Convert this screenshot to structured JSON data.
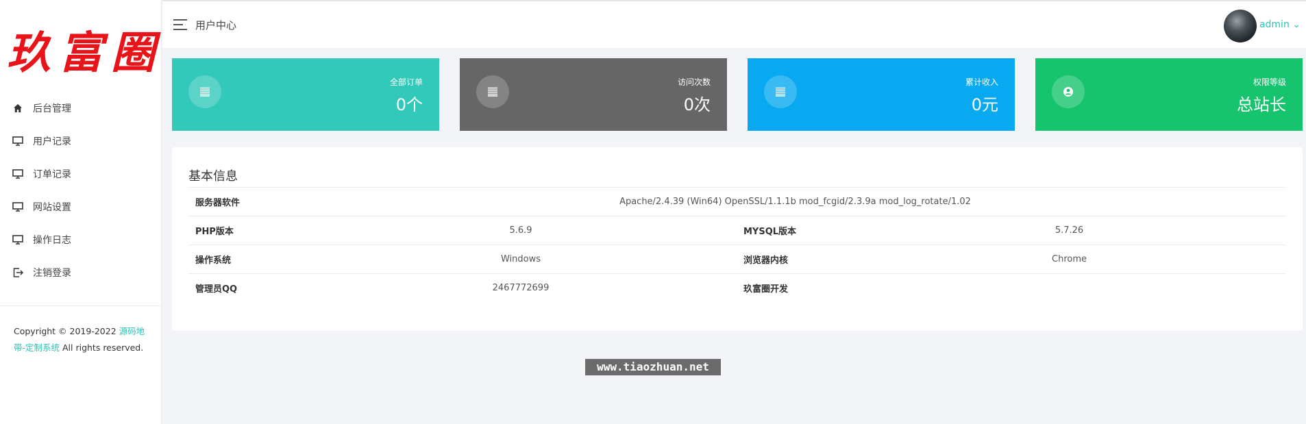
{
  "brand": {
    "logo_text": "玖富圈"
  },
  "sidebar": {
    "items": [
      {
        "label": "后台管理",
        "icon": "home-icon"
      },
      {
        "label": "用户记录",
        "icon": "monitor-icon"
      },
      {
        "label": "订单记录",
        "icon": "monitor-icon"
      },
      {
        "label": "网站设置",
        "icon": "monitor-icon"
      },
      {
        "label": "操作日志",
        "icon": "monitor-icon"
      },
      {
        "label": "注销登录",
        "icon": "logout-icon"
      }
    ],
    "copyright_prefix": "Copyright © 2019-2022 ",
    "copyright_link": "源码地带-定制系统",
    "copyright_suffix": " All rights reserved."
  },
  "header": {
    "title": "用户中心",
    "username": "admin ⌄"
  },
  "cards": [
    {
      "label": "全部订单",
      "value": "0个",
      "color": "#33c9ba",
      "icon": "list-icon"
    },
    {
      "label": "访问次数",
      "value": "0次",
      "color": "#666666",
      "icon": "list-icon"
    },
    {
      "label": "累计收入",
      "value": "0元",
      "color": "#08a9f0",
      "icon": "list-icon"
    },
    {
      "label": "权限等级",
      "value": "总站长",
      "color": "#17c46e",
      "icon": "user-circle-icon"
    }
  ],
  "info": {
    "title": "基本信息",
    "server_software_label": "服务器软件",
    "server_software_value": "Apache/2.4.39 (Win64) OpenSSL/1.1.1b mod_fcgid/2.3.9a mod_log_rotate/1.02",
    "rows": [
      {
        "k1": "PHP版本",
        "v1": "5.6.9",
        "k2": "MYSQL版本",
        "v2": "5.7.26"
      },
      {
        "k1": "操作系统",
        "v1": "Windows",
        "k2": "浏览器内核",
        "v2": "Chrome"
      },
      {
        "k1": "管理员QQ",
        "v1": "2467772699",
        "k2": "玖富圈开发",
        "v2": ""
      }
    ]
  },
  "watermark": "www.tiaozhuan.net"
}
